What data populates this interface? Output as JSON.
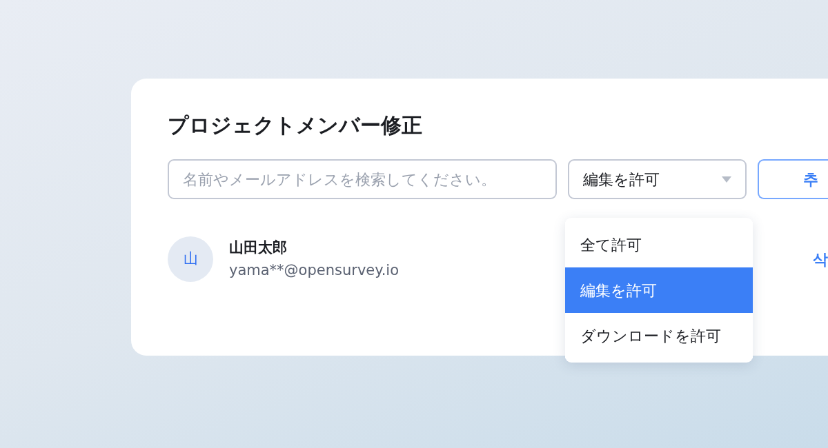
{
  "title": "プロジェクトメンバー修正",
  "search": {
    "placeholder": "名前やメールアドレスを検索してください。"
  },
  "permission_select": {
    "value": "編集を許可"
  },
  "add_button": {
    "label": "추"
  },
  "members": [
    {
      "avatar": "山",
      "name": "山田太郎",
      "email": "yama**@opensurvey.io",
      "action": "삭"
    }
  ],
  "dropdown": {
    "options": [
      {
        "label": "全て許可",
        "selected": false
      },
      {
        "label": "編集を許可",
        "selected": true
      },
      {
        "label": "ダウンロードを許可",
        "selected": false
      }
    ]
  }
}
